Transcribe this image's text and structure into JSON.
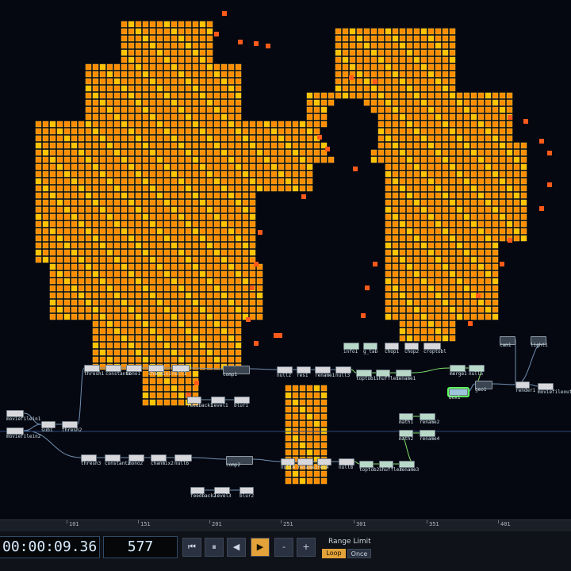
{
  "nodes": [
    {
      "id": "info1",
      "label": "info1",
      "kind": "chop"
    },
    {
      "id": "gtab",
      "label": "g_tab",
      "kind": "chop"
    },
    {
      "id": "chop1",
      "label": "chop1",
      "kind": "top"
    },
    {
      "id": "chop2",
      "label": "chop2",
      "kind": "top"
    },
    {
      "id": "croptobl",
      "label": "croptobl",
      "kind": "top"
    },
    {
      "id": "cam1",
      "label": "cam1",
      "kind": "comp"
    },
    {
      "id": "light1",
      "label": "light1",
      "kind": "comp"
    },
    {
      "id": "thresh1",
      "label": "thresh1",
      "kind": "top"
    },
    {
      "id": "constant1",
      "label": "constant1",
      "kind": "top"
    },
    {
      "id": "mono1",
      "label": "mono1",
      "kind": "top"
    },
    {
      "id": "chanmix1",
      "label": "chanmix1",
      "kind": "top"
    },
    {
      "id": "null1",
      "label": "null1",
      "kind": "top"
    },
    {
      "id": "comp1",
      "label": "comp1",
      "kind": "comp"
    },
    {
      "id": "null2",
      "label": "null2",
      "kind": "top"
    },
    {
      "id": "res1",
      "label": "res1",
      "kind": "top"
    },
    {
      "id": "rename1",
      "label": "rename1",
      "kind": "top"
    },
    {
      "id": "null3",
      "label": "null3",
      "kind": "top"
    },
    {
      "id": "toptob1",
      "label": "toptob1",
      "kind": "chop"
    },
    {
      "id": "shuffle1",
      "label": "shuffle1",
      "kind": "chop"
    },
    {
      "id": "rename1b",
      "label": "rename1",
      "kind": "chop"
    },
    {
      "id": "merge1",
      "label": "merge1",
      "kind": "chop"
    },
    {
      "id": "null5",
      "label": "null5",
      "kind": "chop"
    },
    {
      "id": "geo1",
      "label": "geo1",
      "kind": "comp"
    },
    {
      "id": "box1",
      "label": "box1",
      "kind": "sop"
    },
    {
      "id": "render1",
      "label": "render1",
      "kind": "top"
    },
    {
      "id": "moviefileout1",
      "label": "moviefileout1",
      "kind": "top"
    },
    {
      "id": "feedback1",
      "label": "feedback1",
      "kind": "top"
    },
    {
      "id": "level1",
      "label": "level1",
      "kind": "top"
    },
    {
      "id": "blur1",
      "label": "blur1",
      "kind": "top"
    },
    {
      "id": "moviefilein1",
      "label": "moviefilein1",
      "kind": "top"
    },
    {
      "id": "sub1",
      "label": "sub1",
      "kind": "top"
    },
    {
      "id": "thresh2",
      "label": "thresh2",
      "kind": "top"
    },
    {
      "id": "moviefilein2",
      "label": "moviefilein2",
      "kind": "top"
    },
    {
      "id": "math1",
      "label": "math1",
      "kind": "chop"
    },
    {
      "id": "rename2",
      "label": "rename2",
      "kind": "chop"
    },
    {
      "id": "math2",
      "label": "math2",
      "kind": "chop"
    },
    {
      "id": "rename4",
      "label": "rename4",
      "kind": "chop"
    },
    {
      "id": "thresh3",
      "label": "thresh3",
      "kind": "top"
    },
    {
      "id": "constant2",
      "label": "constant2",
      "kind": "top"
    },
    {
      "id": "mono2",
      "label": "mono2",
      "kind": "top"
    },
    {
      "id": "chanmix2",
      "label": "chanmix2",
      "kind": "top"
    },
    {
      "id": "null6",
      "label": "null6",
      "kind": "top"
    },
    {
      "id": "comp2",
      "label": "comp2",
      "kind": "comp"
    },
    {
      "id": "feedback2",
      "label": "feedback2",
      "kind": "top"
    },
    {
      "id": "level3",
      "label": "level3",
      "kind": "top"
    },
    {
      "id": "blur2",
      "label": "blur2",
      "kind": "top"
    },
    {
      "id": "null4",
      "label": "null4",
      "kind": "top"
    },
    {
      "id": "rename3a",
      "label": "rename3",
      "kind": "top"
    },
    {
      "id": "res4",
      "label": "res4",
      "kind": "top"
    },
    {
      "id": "null8",
      "label": "null8",
      "kind": "top"
    },
    {
      "id": "toptob2",
      "label": "toptob2",
      "kind": "chop"
    },
    {
      "id": "shuffle3",
      "label": "shuffle3",
      "kind": "chop"
    },
    {
      "id": "rename3b",
      "label": "rename3",
      "kind": "chop"
    }
  ],
  "timeline": {
    "ticks": [
      "101",
      "151",
      "201",
      "251",
      "301",
      "351",
      "401"
    ]
  },
  "transport": {
    "timecode": "00:00:09.36",
    "frame": "577",
    "buttons": {
      "rewind": "⏮",
      "pause": "⏸",
      "step_back": "◀",
      "play": "▶",
      "minus": "-",
      "plus": "+"
    },
    "range_limit_label": "Range Limit",
    "loop_label": "Loop",
    "once_label": "Once"
  },
  "colors": {
    "voxel_orange": "#ff8c00",
    "voxel_yellow": "#ffc400",
    "wire": "#6f8fb0",
    "chop_wire": "#7ee06a",
    "selection": "#5cff5c",
    "play_active": "#e3a23a"
  }
}
